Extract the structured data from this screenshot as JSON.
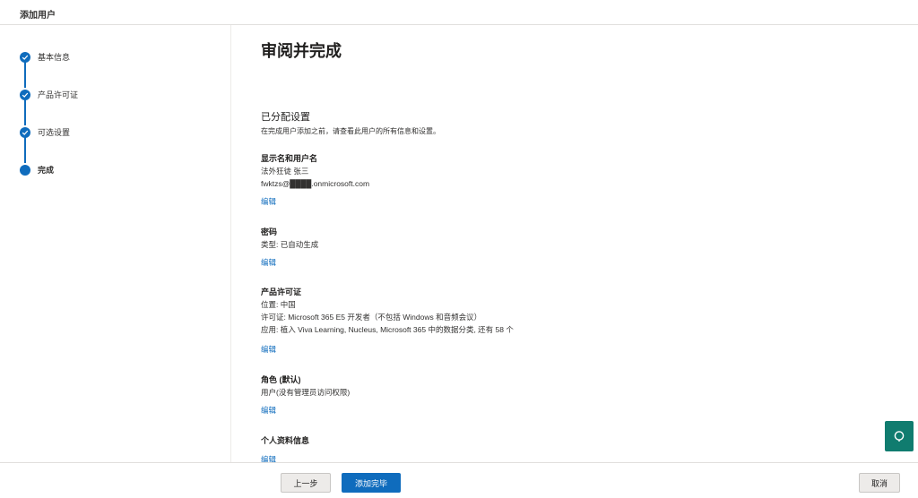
{
  "header": {
    "title": "添加用户"
  },
  "steps": [
    {
      "label": "基本信息",
      "status": "done"
    },
    {
      "label": "产品许可证",
      "status": "done"
    },
    {
      "label": "可选设置",
      "status": "done"
    },
    {
      "label": "完成",
      "status": "current"
    }
  ],
  "main": {
    "heading": "审阅并完成",
    "section_title": "已分配设置",
    "section_desc": "在完成用户添加之前，请查看此用户的所有信息和设置。",
    "blocks": [
      {
        "title": "显示名和用户名",
        "lines": [
          "法外狂徒 张三",
          "fwktzs@████.onmicrosoft.com"
        ],
        "edit": "编辑"
      },
      {
        "title": "密码",
        "lines": [
          "类型: 已自动生成"
        ],
        "edit": "编辑"
      },
      {
        "title": "产品许可证",
        "lines": [
          "位置: 中国",
          "许可证: Microsoft 365 E5 开发者（不包括 Windows 和音频会议）",
          "应用: 植入 Viva Learning, Nucleus, Microsoft 365 中的数据分类, 还有 58 个"
        ],
        "edit": "编辑"
      },
      {
        "title": "角色 (默认)",
        "lines": [
          "用户(没有管理员访问权限)"
        ],
        "edit": "编辑"
      },
      {
        "title": "个人资料信息",
        "lines": [],
        "edit": "编辑"
      }
    ]
  },
  "footer": {
    "back": "上一步",
    "add": "添加完毕",
    "cancel": "取消"
  },
  "colors": {
    "accent": "#0f6cbd",
    "fab": "#107c6f"
  }
}
